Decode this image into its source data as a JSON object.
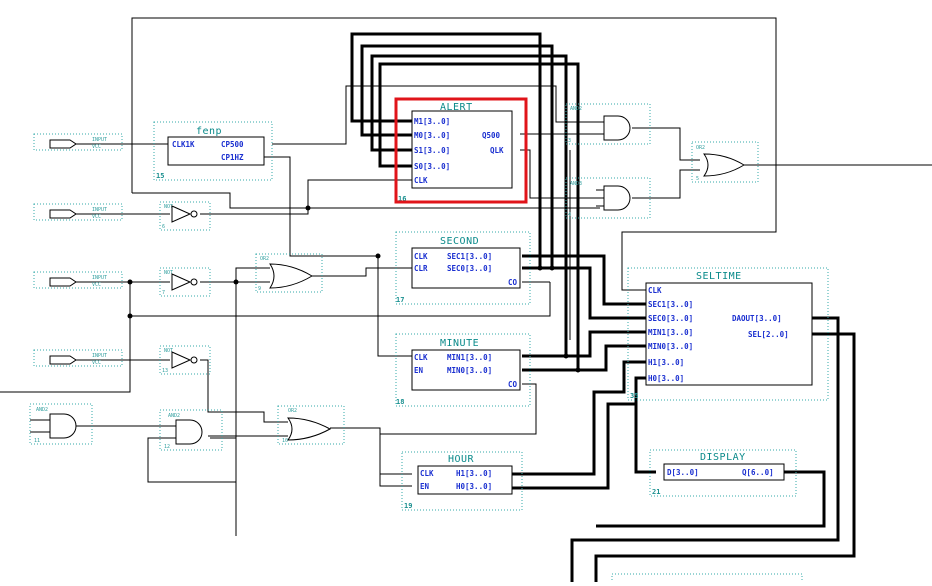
{
  "blocks": {
    "fenp": {
      "title": "fenp",
      "inputs": [
        "CLK1K"
      ],
      "outputs": [
        "CP500",
        "CP1HZ"
      ],
      "number": "15"
    },
    "alert": {
      "title": "ALERT",
      "inputs": [
        "M1[3..0]",
        "M0[3..0]",
        "S1[3..0]",
        "S0[3..0]",
        "CLK"
      ],
      "outputs": [
        "Q500",
        "QLK"
      ],
      "number": "16"
    },
    "second": {
      "title": "SECOND",
      "inputs": [
        "CLK",
        "CLR"
      ],
      "outputs": [
        "SEC1[3..0]",
        "SEC0[3..0]",
        "CO"
      ],
      "number": "17"
    },
    "minute": {
      "title": "MINUTE",
      "inputs": [
        "CLK",
        "EN"
      ],
      "outputs": [
        "MIN1[3..0]",
        "MIN0[3..0]",
        "CO"
      ],
      "number": "18"
    },
    "hour": {
      "title": "HOUR",
      "inputs": [
        "CLK",
        "EN"
      ],
      "outputs": [
        "H1[3..0]",
        "H0[3..0]"
      ],
      "number": "19"
    },
    "seltime": {
      "title": "SELTIME",
      "inputs": [
        "CLK",
        "SEC1[3..0]",
        "SEC0[3..0]",
        "MIN1[3..0]",
        "MIN0[3..0]",
        "H1[3..0]",
        "H0[3..0]"
      ],
      "outputs": [
        "DAOUT[3..0]",
        "SEL[2..0]"
      ],
      "number": "35"
    },
    "display": {
      "title": "DISPLAY",
      "inputs": [
        "D[3..0]"
      ],
      "outputs": [
        "Q[6..0]"
      ],
      "number": "21"
    }
  },
  "gates": {
    "and2_top": {
      "label": "AND2",
      "number": "3"
    },
    "and3": {
      "label": "AND3",
      "number": "4"
    },
    "or2_top": {
      "label": "OR2",
      "number": "5"
    },
    "not_1": {
      "label": "NOT",
      "number": "6"
    },
    "not_2": {
      "label": "NOT",
      "number": "7"
    },
    "or2_mid": {
      "label": "OR2",
      "number": "9"
    },
    "not_3": {
      "label": "NOT",
      "number": "13"
    },
    "and2_left": {
      "label": "AND2",
      "number": "11"
    },
    "and2_mid": {
      "label": "AND2",
      "number": "12"
    },
    "or2_low": {
      "label": "OR2",
      "number": "10"
    }
  },
  "pins": {
    "input_label": "INPUT",
    "vcc_label": "VCC"
  },
  "colors": {
    "highlight": "#e0141a",
    "port_text": "#1a2fd0",
    "title_text": "#0a8a8a",
    "dotted": "#33aaaa"
  }
}
